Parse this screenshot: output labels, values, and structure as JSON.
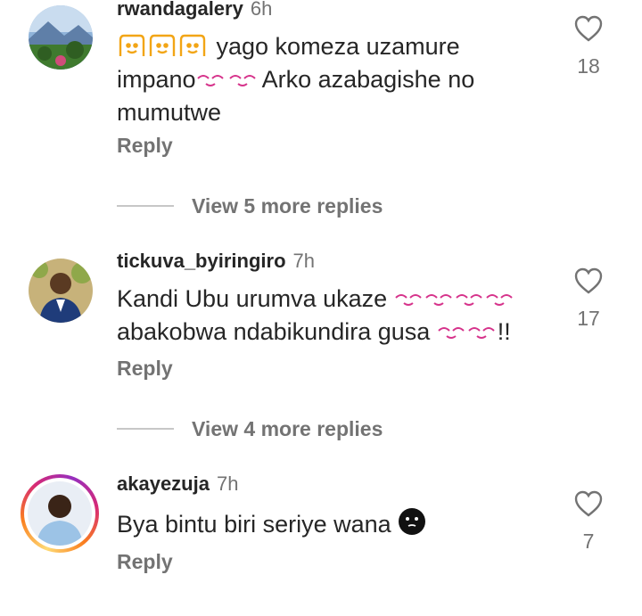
{
  "comments": [
    {
      "username": "rwandagalery",
      "time": "6h",
      "text_line1_suffix": " yago komeza uzamure",
      "text_line2_prefix": "impano",
      "text_line2_suffix": " Arko azabagishe no",
      "text_line3": "mumutwe",
      "reply_label": "Reply",
      "like_count": "18",
      "view_more": "View 5 more replies"
    },
    {
      "username": "tickuva_byiringiro",
      "time": "7h",
      "text_line1_prefix": "Kandi Ubu urumva ukaze ",
      "text_line2_prefix": "abakobwa ndabikundira gusa ",
      "text_line2_suffix": "!!",
      "reply_label": "Reply",
      "like_count": "17",
      "view_more": "View 4 more replies"
    },
    {
      "username": "akayezuja",
      "time": "7h",
      "text_prefix": "Bya bintu biri seriye wana ",
      "reply_label": "Reply",
      "like_count": "7"
    }
  ],
  "icons": {
    "like": "heart-outline-icon",
    "emoji_hands": "raising-hands-emoji-icon",
    "emoji_kiss": "kissing-face-emoji-icon",
    "emoji_dark": "dark-face-emoji-icon"
  },
  "colors": {
    "text": "#262626",
    "muted": "#737373",
    "emoji_kiss": "#d6338b",
    "emoji_hands": "#f2a516"
  }
}
